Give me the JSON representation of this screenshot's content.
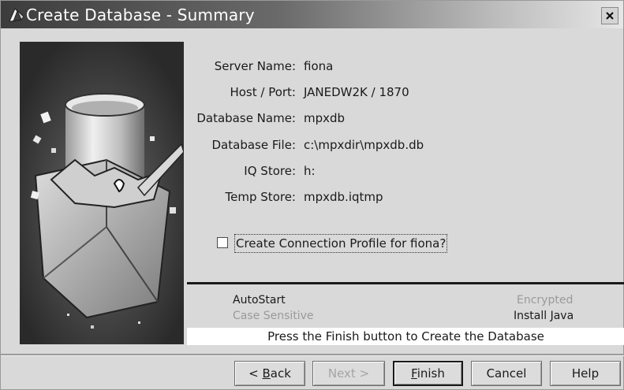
{
  "window": {
    "title": "Create Database - Summary"
  },
  "summary": {
    "server_name": {
      "label": "Server Name:",
      "value": "fiona"
    },
    "host_port": {
      "label": "Host / Port:",
      "value": "JANEDW2K / 1870"
    },
    "database_name": {
      "label": "Database Name:",
      "value": "mpxdb"
    },
    "database_file": {
      "label": "Database File:",
      "value": "c:\\mpxdir\\mpxdb.db"
    },
    "iq_store": {
      "label": "IQ Store:",
      "value": "h:"
    },
    "temp_store": {
      "label": "Temp Store:",
      "value": "mpxdb.iqtmp"
    }
  },
  "connection_profile": {
    "label": "Create  Connection Profile for fiona?",
    "checked": false
  },
  "options": {
    "autostart": {
      "label": "AutoStart",
      "enabled": true
    },
    "case_sensitive": {
      "label": "Case Sensitive",
      "enabled": false
    },
    "encrypted": {
      "label": "Encrypted",
      "enabled": false
    },
    "install_java": {
      "label": "Install Java",
      "enabled": true
    }
  },
  "status": {
    "message": "Press the Finish button to Create the Database"
  },
  "buttons": {
    "back": {
      "prefix": "< ",
      "mnemonic": "B",
      "rest": "ack"
    },
    "next": {
      "label": "Next >"
    },
    "finish": {
      "mnemonic": "F",
      "rest": "inish"
    },
    "cancel": {
      "label": "Cancel"
    },
    "help": {
      "label": "Help"
    }
  }
}
